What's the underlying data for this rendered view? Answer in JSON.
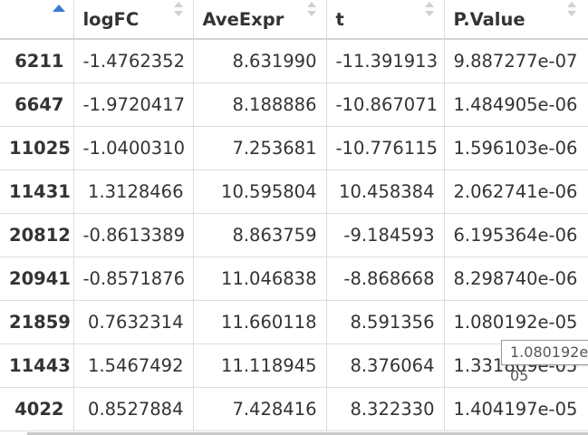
{
  "table": {
    "columns": [
      {
        "label": "",
        "sorted": "ascending"
      },
      {
        "label": "logFC"
      },
      {
        "label": "AveExpr"
      },
      {
        "label": "t"
      },
      {
        "label": "P.Value"
      }
    ],
    "rows": [
      {
        "name": "6211",
        "logFC": "-1.4762352",
        "AveExpr": "8.631990",
        "t": "-11.391913",
        "P.Value": "9.887277e-07"
      },
      {
        "name": "6647",
        "logFC": "-1.9720417",
        "AveExpr": "8.188886",
        "t": "-10.867071",
        "P.Value": "1.484905e-06"
      },
      {
        "name": "11025",
        "logFC": "-1.0400310",
        "AveExpr": "7.253681",
        "t": "-10.776115",
        "P.Value": "1.596103e-06"
      },
      {
        "name": "11431",
        "logFC": "1.3128466",
        "AveExpr": "10.595804",
        "t": "10.458384",
        "P.Value": "2.062741e-06"
      },
      {
        "name": "20812",
        "logFC": "-0.8613389",
        "AveExpr": "8.863759",
        "t": "-9.184593",
        "P.Value": "6.195364e-06"
      },
      {
        "name": "20941",
        "logFC": "-0.8571876",
        "AveExpr": "11.046838",
        "t": "-8.868668",
        "P.Value": "8.298740e-06"
      },
      {
        "name": "21859",
        "logFC": "0.7632314",
        "AveExpr": "11.660118",
        "t": "8.591356",
        "P.Value": "1.080192e-05"
      },
      {
        "name": "11443",
        "logFC": "1.5467492",
        "AveExpr": "11.118945",
        "t": "8.376064",
        "P.Value": "1.331809e-05"
      },
      {
        "name": "4022",
        "logFC": "0.8527884",
        "AveExpr": "7.428416",
        "t": "8.322330",
        "P.Value": "1.404197e-05"
      }
    ]
  },
  "tooltip": {
    "text": "1.080192e-05"
  },
  "colors": {
    "sort_active": "#3a7bd5",
    "sort_inactive": "#d0d0d0",
    "grid": "#dcdcdc"
  }
}
